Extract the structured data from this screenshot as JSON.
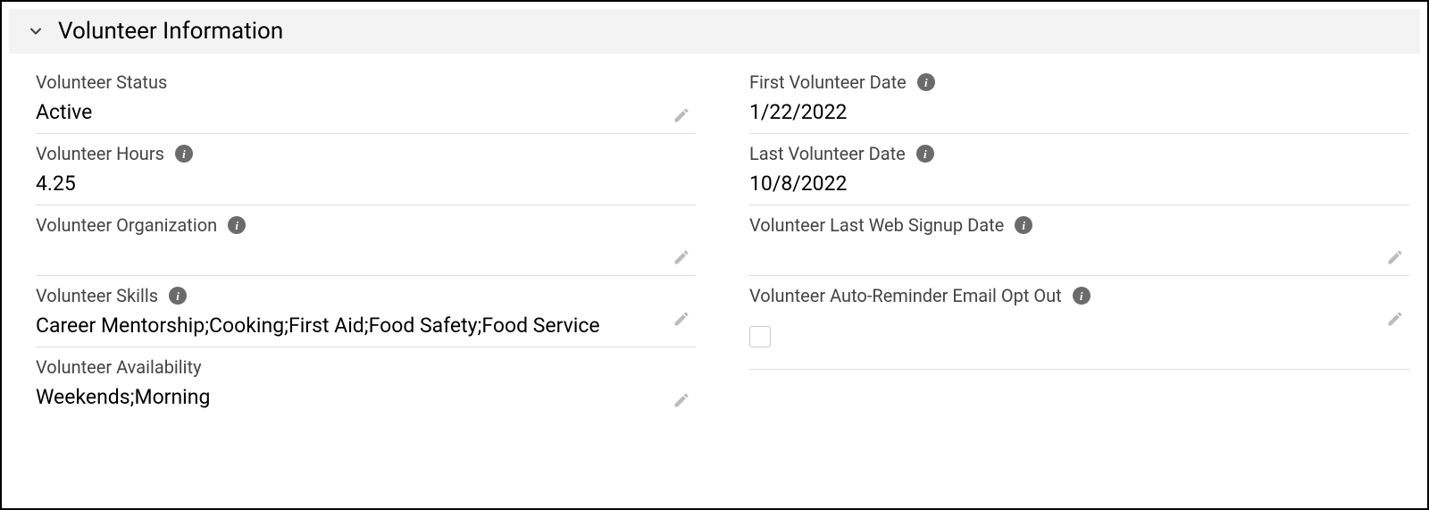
{
  "section": {
    "title": "Volunteer Information"
  },
  "left": {
    "status": {
      "label": "Volunteer Status",
      "value": "Active",
      "editable": true,
      "info": false
    },
    "hours": {
      "label": "Volunteer Hours",
      "value": "4.25",
      "editable": false,
      "info": true
    },
    "organization": {
      "label": "Volunteer Organization",
      "value": "",
      "editable": true,
      "info": true
    },
    "skills": {
      "label": "Volunteer Skills",
      "value": "Career Mentorship;Cooking;First Aid;Food Safety;Food Service",
      "editable": true,
      "info": true
    },
    "availability": {
      "label": "Volunteer Availability",
      "value": "Weekends;Morning",
      "editable": true,
      "info": false
    }
  },
  "right": {
    "firstDate": {
      "label": "First Volunteer Date",
      "value": "1/22/2022",
      "editable": false,
      "info": true
    },
    "lastDate": {
      "label": "Last Volunteer Date",
      "value": "10/8/2022",
      "editable": false,
      "info": true
    },
    "lastWebSignup": {
      "label": "Volunteer Last Web Signup Date",
      "value": "",
      "editable": true,
      "info": true
    },
    "optOut": {
      "label": "Volunteer Auto-Reminder Email Opt Out",
      "checked": false,
      "editable": true,
      "info": true
    }
  }
}
